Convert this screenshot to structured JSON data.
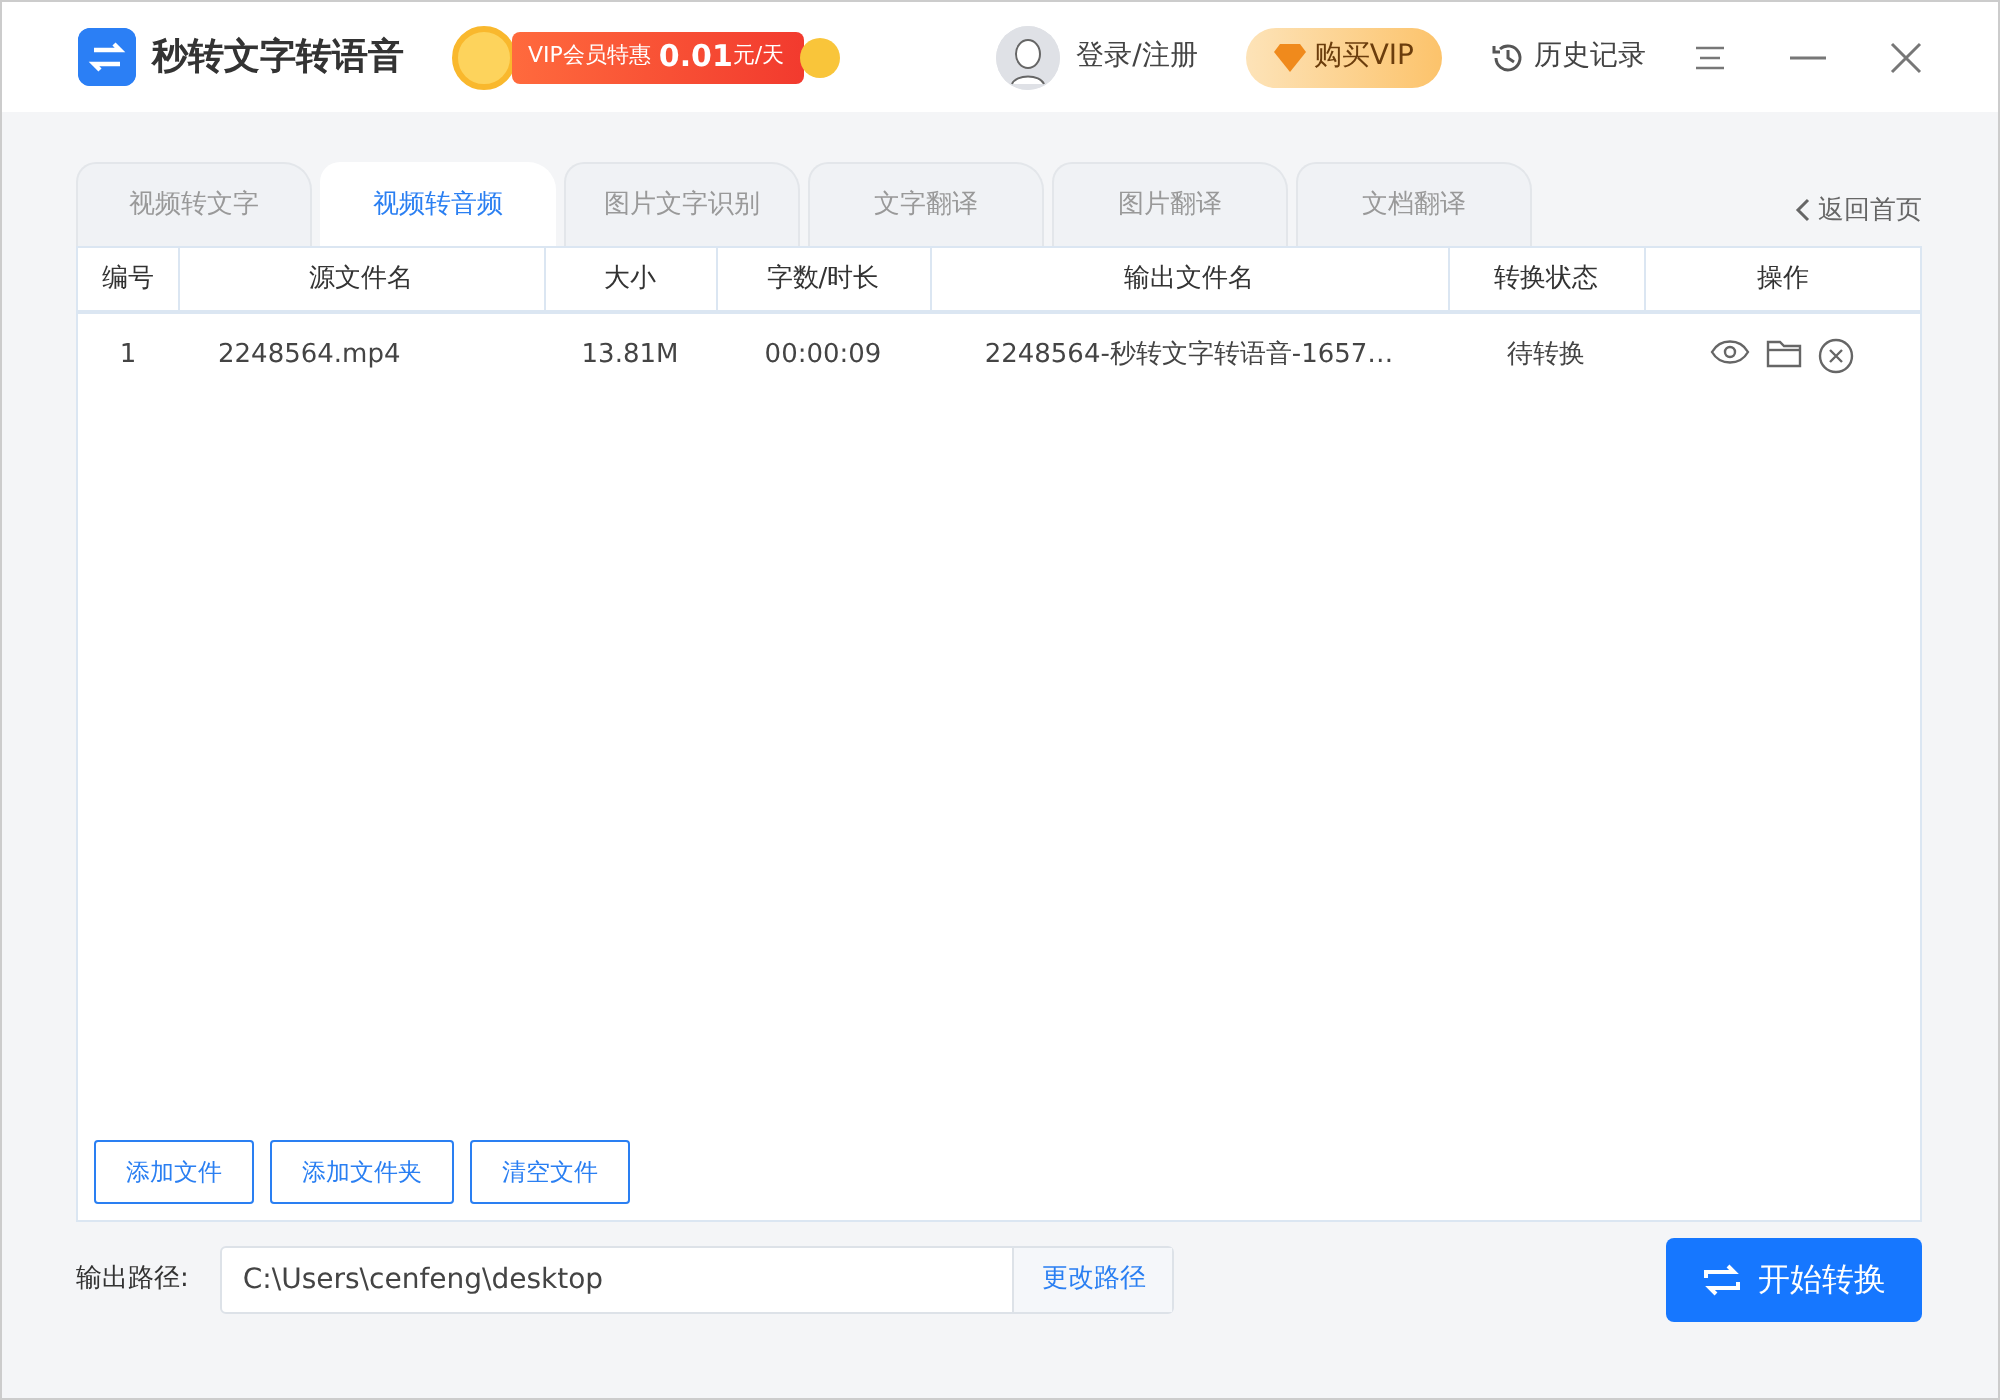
{
  "app": {
    "title": "秒转文字转语音",
    "promo": {
      "label": "VIP会员特惠",
      "price": "0.01",
      "unit": "元/天"
    },
    "login": "登录/注册",
    "buy_vip": "购买VIP",
    "history": "历史记录"
  },
  "tabs": [
    {
      "label": "视频转文字",
      "selected": false
    },
    {
      "label": "视频转音频",
      "selected": true
    },
    {
      "label": "图片文字识别",
      "selected": false
    },
    {
      "label": "文字翻译",
      "selected": false
    },
    {
      "label": "图片翻译",
      "selected": false
    },
    {
      "label": "文档翻译",
      "selected": false
    }
  ],
  "back_link": "返回首页",
  "table": {
    "columns": [
      "编号",
      "源文件名",
      "大小",
      "字数/时长",
      "输出文件名",
      "转换状态",
      "操作"
    ],
    "rows": [
      [
        "1",
        "2248564.mp4",
        "13.81M",
        "00:00:09",
        "2248564-秒转文字转语音-1657…",
        "待转换"
      ]
    ]
  },
  "file_buttons": [
    "添加文件",
    "添加文件夹",
    "清空文件"
  ],
  "output": {
    "label": "输出路径:",
    "path": "C:\\Users\\cenfeng\\desktop",
    "change": "更改路径"
  },
  "start_button": "开始转换"
}
